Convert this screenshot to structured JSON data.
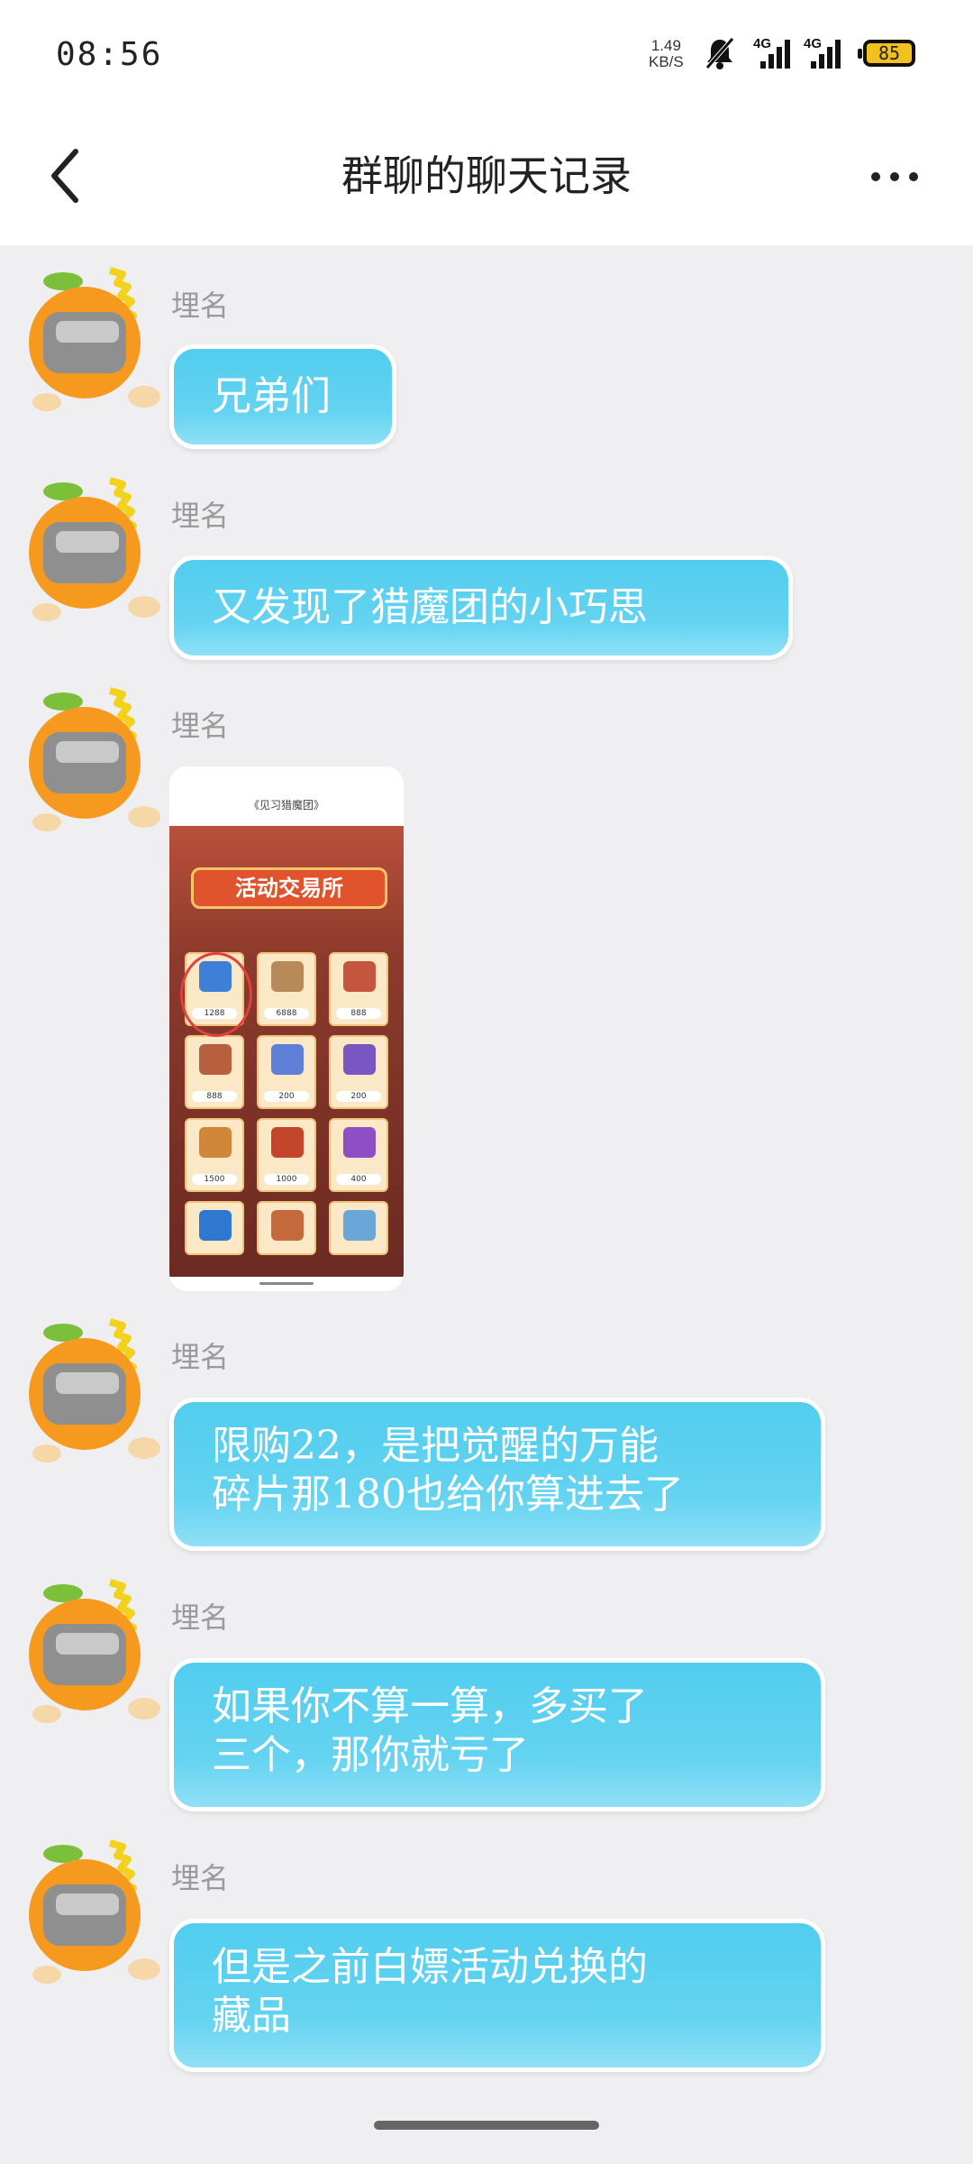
{
  "status_bar": {
    "time": "08:56",
    "net_speed_value": "1.49",
    "net_speed_unit": "KB/S",
    "signal1_label": "4G",
    "signal2_label": "4G",
    "battery": "85"
  },
  "header": {
    "title": "群聊的聊天记录"
  },
  "messages": [
    {
      "sender": "埋名",
      "text": "兄弟们"
    },
    {
      "sender": "埋名",
      "text": "又发现了猎魔团的小巧思"
    },
    {
      "sender": "埋名",
      "type": "image",
      "image": {
        "title": "《见习猎魔团》",
        "banner": "活动交易所",
        "prices": [
          "1288",
          "6888",
          "888",
          "888",
          "200",
          "200",
          "1500",
          "1000",
          "400"
        ]
      }
    },
    {
      "sender": "埋名",
      "text": "限购22，是把觉醒的万能\n碎片那180也给你算进去了"
    },
    {
      "sender": "埋名",
      "text": "如果你不算一算，多买了\n三个，那你就亏了"
    },
    {
      "sender": "埋名",
      "text": "但是之前白嫖活动兑换的\n藏品"
    }
  ],
  "colors": {
    "bubble": "#52cdee",
    "background": "#efeff2",
    "avatar_orange": "#f59a1e"
  }
}
